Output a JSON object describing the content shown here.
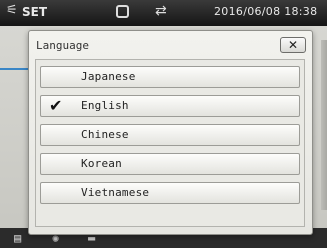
{
  "status_bar": {
    "mode_label": "SET",
    "datetime": "2016/06/08 18:38"
  },
  "dialog": {
    "title": "Language",
    "close_label": "✕",
    "options": [
      {
        "label": "Japanese",
        "selected": false
      },
      {
        "label": "English",
        "selected": true
      },
      {
        "label": "Chinese",
        "selected": false
      },
      {
        "label": "Korean",
        "selected": false
      },
      {
        "label": "Vietnamese",
        "selected": false
      }
    ],
    "check_icon": "✔"
  },
  "icons": {
    "settings": "⚟",
    "plug": "⇄"
  }
}
